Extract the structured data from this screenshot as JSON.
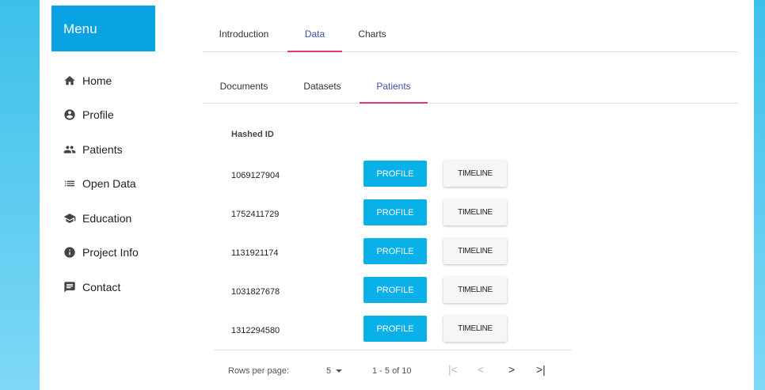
{
  "sidebar": {
    "title": "Menu",
    "items": [
      {
        "label": "Home",
        "icon": "home-icon"
      },
      {
        "label": "Profile",
        "icon": "account-circle-icon"
      },
      {
        "label": "Patients",
        "icon": "people-icon"
      },
      {
        "label": "Open Data",
        "icon": "list-icon"
      },
      {
        "label": "Education",
        "icon": "school-icon"
      },
      {
        "label": "Project Info",
        "icon": "info-icon"
      },
      {
        "label": "Contact",
        "icon": "chat-icon"
      }
    ]
  },
  "top_tabs": {
    "items": [
      {
        "label": "Introduction"
      },
      {
        "label": "Data",
        "active": true
      },
      {
        "label": "Charts"
      }
    ]
  },
  "sub_tabs": {
    "items": [
      {
        "label": "Documents"
      },
      {
        "label": "Datasets"
      },
      {
        "label": "Patients",
        "active": true
      }
    ]
  },
  "table": {
    "header": "Hashed ID",
    "profile_label": "PROFILE",
    "timeline_label": "TIMELINE",
    "rows": [
      {
        "id": "1069127904"
      },
      {
        "id": "1752411729"
      },
      {
        "id": "1131921174"
      },
      {
        "id": "1031827678"
      },
      {
        "id": "1312294580"
      }
    ]
  },
  "pagination": {
    "rows_per_page_label": "Rows per page:",
    "rows_per_page": "5",
    "range": "1 - 5 of 10",
    "first": "|<",
    "prev": "<",
    "next": ">",
    "last": ">|"
  },
  "colors": {
    "menu_header": "#09a3e4",
    "profile_button": "#0ab0e8",
    "active_tab_text": "#3f51b5",
    "active_tab_indicator": "#e2387a",
    "background_top": "#3cc0ea",
    "background_bottom": "#7fd8f6"
  }
}
